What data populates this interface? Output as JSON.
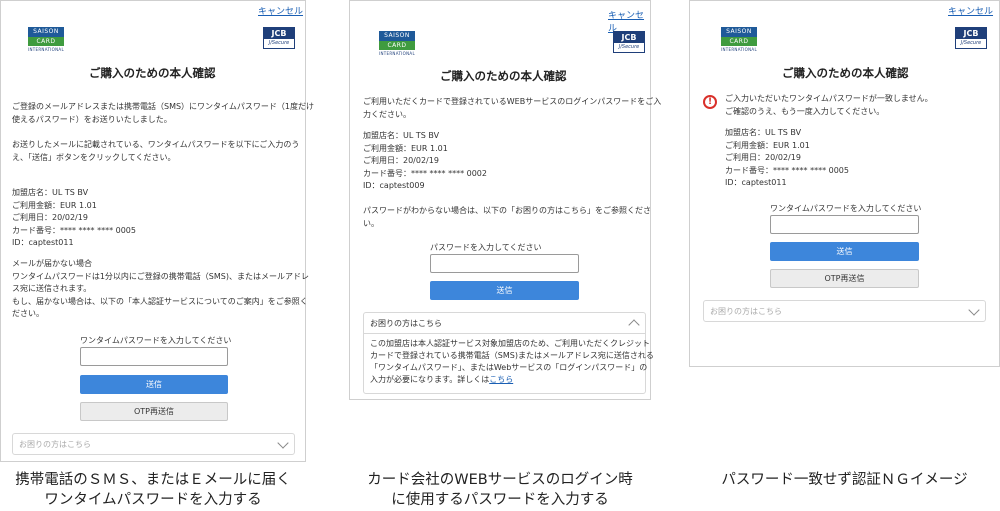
{
  "common": {
    "cancel": "キャンセル",
    "saison_top": "SAISON",
    "saison_mid": "CARD",
    "saison_bottom": "INTERNATIONAL",
    "jcb_top": "JCB",
    "jcb_bottom": "J/Secure",
    "title": "ご購入のための本人確認"
  },
  "panel1": {
    "intro": [
      "ご登録のメールアドレスまたは携帯電話（SMS）にワンタイムパスワード（1度だけ",
      "使えるパスワード）をお送りいたしました。"
    ],
    "instruct": [
      "お送りしたメールに記載されている、ワンタイムパスワードを以下にご入力のう",
      "え、「送信」ボタンをクリックしてください。"
    ],
    "details": [
      "加盟店名：UL TS BV",
      "ご利用金額：EUR 1.01",
      "ご利用日：20/02/19",
      "カード番号：**** **** **** 0005",
      "ID：captest011"
    ],
    "notice": [
      "メールが届かない場合",
      "ワンタイムパスワードは1分以内にご登録の携帯電話（SMS)、またはメールアドレ",
      "ス宛に送信されます。",
      "もし、届かない場合は、以下の「本人認証サービスについてのご案内」をご参照く",
      "ださい。"
    ],
    "input_label": "ワンタイムパスワードを入力してください",
    "submit": "送信",
    "resend": "OTP再送信",
    "help": "お困りの方はこちら"
  },
  "panel2": {
    "intro": [
      "ご利用いただくカードで登録されているWEBサービスのログインパスワードをご入",
      "力ください。"
    ],
    "details": [
      "加盟店名：UL TS BV",
      "ご利用金額：EUR 1.01",
      "ご利用日：20/02/19",
      "カード番号：**** **** **** 0002",
      "ID：captest009"
    ],
    "forgot": [
      "パスワードがわからない場合は、以下の「お困りの方はこちら」をご参照くださ",
      "い。"
    ],
    "input_label": "パスワードを入力してください",
    "submit": "送信",
    "help": "お困りの方はこちら",
    "help_body": [
      "この加盟店は本人認証サービス対象加盟店のため、ご利用いただくクレジット",
      "カードで登録されている携帯電話（SMS)またはメールアドレス宛に送信される",
      "「ワンタイムパスワード」、またはWebサービスの「ログインパスワード」の"
    ],
    "help_last": "入力が必要になります。詳しくは",
    "help_link": "こちら"
  },
  "panel3": {
    "error": [
      "ご入力いただいたワンタイムパスワードが一致しません。",
      "ご確認のうえ、もう一度入力してください。"
    ],
    "details": [
      "加盟店名：UL TS BV",
      "ご利用金額：EUR 1.01",
      "ご利用日：20/02/19",
      "カード番号：**** **** **** 0005",
      "ID：captest011"
    ],
    "input_label": "ワンタイムパスワードを入力してください",
    "submit": "送信",
    "resend": "OTP再送信",
    "help": "お困りの方はこちら"
  },
  "captions": {
    "c1": [
      "携帯電話のＳＭＳ、またはＥメールに届く",
      "ワンタイムパスワードを入力する"
    ],
    "c2": [
      "カード会社のWEBサービスのログイン時",
      "に使用するパスワードを入力する"
    ],
    "c3": [
      "パスワード一致せず認証ＮＧイメージ"
    ]
  },
  "colors": {
    "primary_button": "#3d86db",
    "error": "#d9302a",
    "link": "#1a5fb4"
  }
}
